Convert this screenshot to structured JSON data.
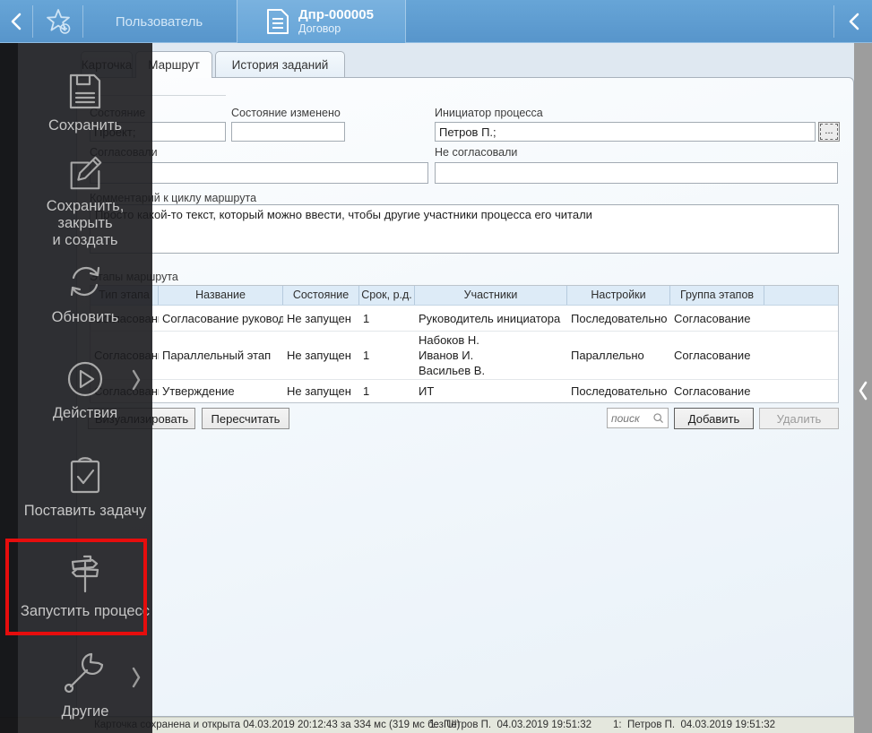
{
  "topbar": {
    "user_tab": "Пользователь",
    "doc_tab": {
      "title": "Дпр-000005",
      "subtitle": "Договор"
    }
  },
  "tabs": {
    "card": "Карточка",
    "route": "Маршрут",
    "history": "История заданий"
  },
  "form": {
    "state": {
      "label": "Состояние",
      "value": "Проект;"
    },
    "state_changed": {
      "label": "Состояние изменено",
      "value": ""
    },
    "initiator": {
      "label": "Инициатор процесса",
      "value": "Петров П.;",
      "button": "..."
    },
    "approved": {
      "label": "Согласовали",
      "value": ""
    },
    "not_approved": {
      "label": "Не согласовали",
      "value": ""
    },
    "comment": {
      "label": "Комментарий к циклу маршрута",
      "value": "Просто какой-то текст, который можно ввести, чтобы другие участники процесса его читали"
    }
  },
  "stages": {
    "group_label": "Этапы маршрута",
    "columns": [
      "Тип этапа",
      "Название",
      "Состояние",
      "Срок, р.д.",
      "Участники",
      "Настройки",
      "Группа этапов"
    ],
    "rows": [
      {
        "type": "Согласование",
        "name": "Согласование руководителем",
        "state": "Не запущен",
        "term": "1",
        "participants": "Руководитель инициатора",
        "settings": "Последовательно",
        "group": "Согласование"
      },
      {
        "type": "Согласование",
        "name": "Параллельный этап",
        "state": "Не запущен",
        "term": "1",
        "participants": "Набоков Н.\nИванов И.\nВасильев В.",
        "settings": "Параллельно",
        "group": "Согласование"
      },
      {
        "type": "Согласование",
        "name": "Утверждение",
        "state": "Не запущен",
        "term": "1",
        "participants": "ИТ",
        "settings": "Последовательно",
        "group": "Согласование"
      }
    ],
    "buttons": {
      "visualize": "Визуализировать",
      "recalculate": "Пересчитать",
      "add": "Добавить",
      "delete": "Удалить"
    },
    "search_placeholder": "поиск"
  },
  "menu": {
    "items": [
      {
        "label": "Сохранить"
      },
      {
        "label": "Сохранить, закрыть\nи создать"
      },
      {
        "label": "Обновить"
      },
      {
        "label": "Действия"
      },
      {
        "label": "Поставить задачу"
      },
      {
        "label": "Запустить процесс"
      },
      {
        "label": "Другие"
      }
    ]
  },
  "statusbar": {
    "message": "Карточка сохранена и открыта 04.03.2019 20:12:43 за 334 мс (319 мс без UI)",
    "entry1": "1:  Петров П.  04.03.2019 19:51:32",
    "entry2": "1:  Петров П.  04.03.2019 19:51:32"
  },
  "colors": {
    "topbar": "#5b9ace",
    "highlight_red": "#e60d0d",
    "table_header_bg": "#ddebf7",
    "status_bg": "#e4e7dd",
    "overlay": "#1b1b1e",
    "right_strip": "#9d9d9d"
  }
}
